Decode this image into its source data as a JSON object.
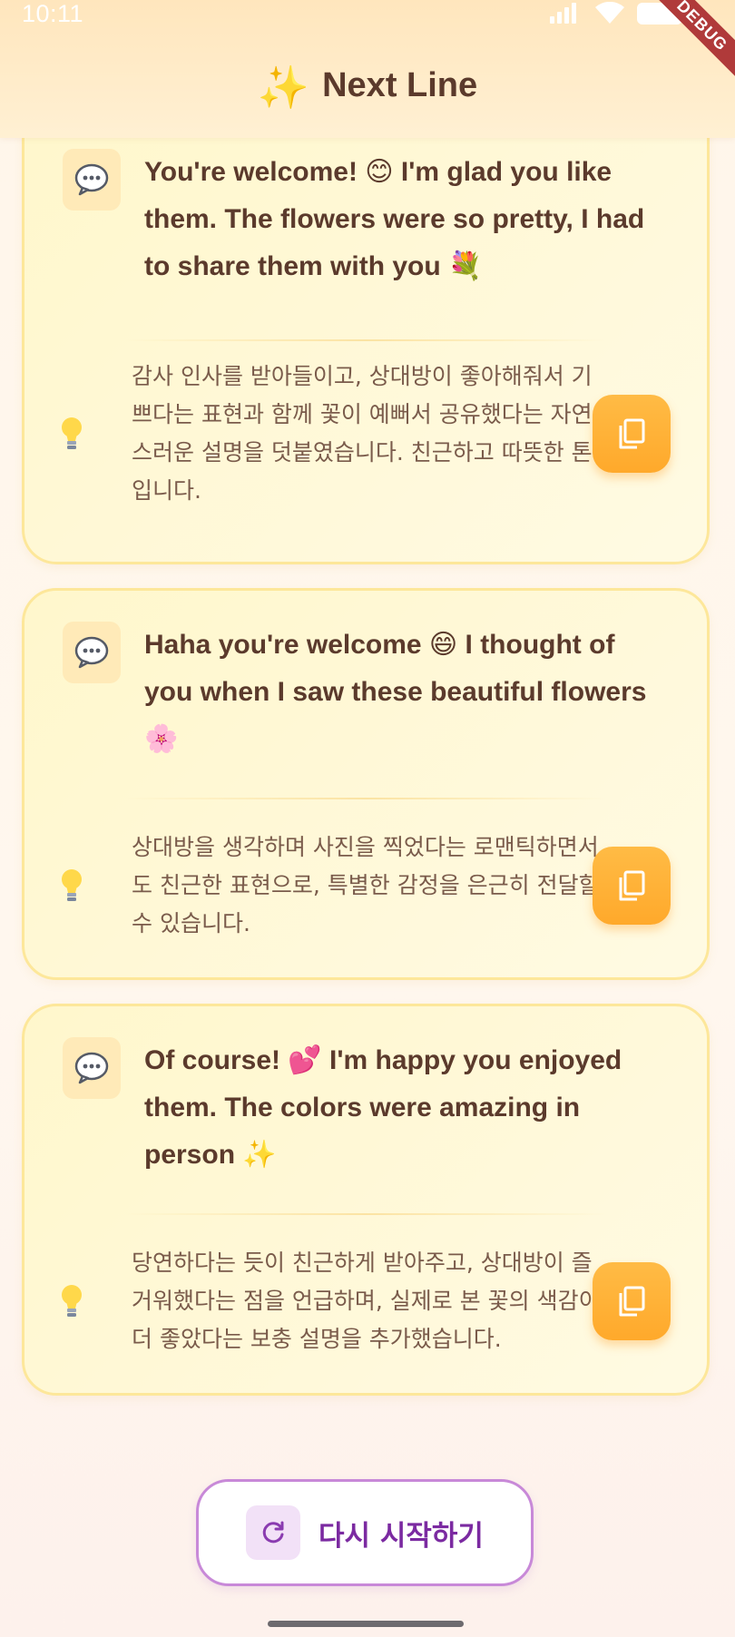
{
  "status_bar": {
    "time": "10:11",
    "debug_label": "DEBUG"
  },
  "app_bar": {
    "title": "Next Line",
    "title_icon": "sparkles-icon"
  },
  "suggestions": [
    {
      "message": "You're welcome! 😊 I'm glad you like them. The flowers were so pretty, I had to share them with you 💐",
      "tip": "감사 인사를 받아들이고, 상대방이 좋아해줘서 기쁘다는 표현과 함께 꽃이 예뻐서 공유했다는 자연스러운 설명을 덧붙였습니다. 친근하고 따뜻한 톤입니다."
    },
    {
      "message": "Haha you're welcome 😄 I thought of you when I saw these beautiful flowers 🌸",
      "tip": "상대방을 생각하며 사진을 찍었다는 로맨틱하면서도 친근한 표현으로, 특별한 감정을 은근히 전달할 수 있습니다."
    },
    {
      "message": "Of course! 💕 I'm happy you enjoyed them. The colors were amazing in person ✨",
      "tip": "당연하다는 듯이 친근하게 받아주고, 상대방이 즐거워했다는 점을 언급하며, 실제로 본 꽃의 색감이 더 좋았다는 보충 설명을 추가했습니다."
    }
  ],
  "icons": {
    "message": "chat-bubble-icon",
    "tip": "lightbulb-icon",
    "copy": "copy-icon",
    "restart": "refresh-icon"
  },
  "restart_button": {
    "label": "다시 시작하기"
  },
  "colors": {
    "accent_orange": "#ffa92b",
    "card_border": "#fde79a",
    "text_brown": "#5b3a2c",
    "restart_purple": "#7b2aa1",
    "restart_border": "#c889d8",
    "debug_red": "#b03a3a"
  }
}
